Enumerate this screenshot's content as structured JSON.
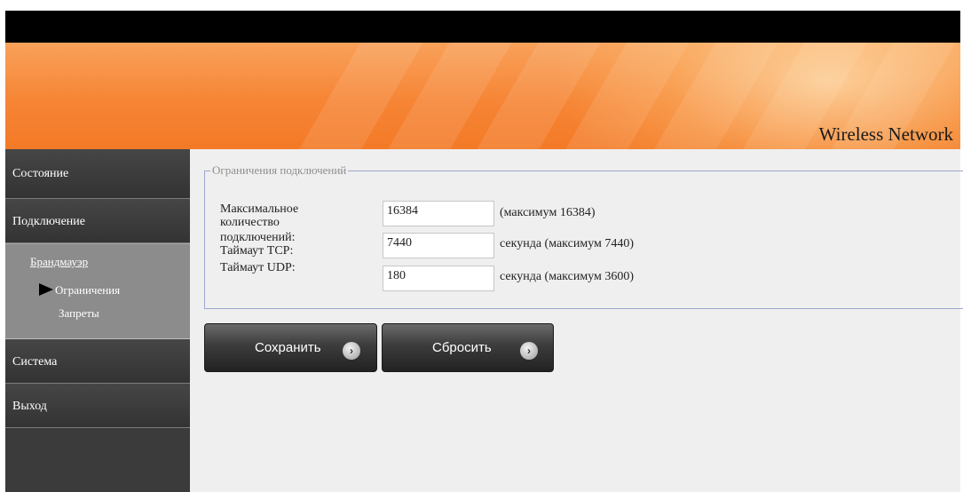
{
  "header": {
    "brand": "Wireless Network"
  },
  "sidebar": {
    "items": [
      {
        "label": "Состояние"
      },
      {
        "label": "Подключение"
      }
    ],
    "group": {
      "title": "Брандмауэр",
      "active": "Ограничения",
      "other": "Запреты"
    },
    "items_after": [
      {
        "label": "Система"
      },
      {
        "label": "Выход"
      }
    ]
  },
  "form": {
    "legend": "Ограничения подключений",
    "labels": {
      "max_line1": "Максимальное",
      "max_line2": "количество",
      "max_line3": "подключений:",
      "tcp": "Таймаут TCP:",
      "udp": "Таймаут UDP:"
    },
    "fields": {
      "max_connections": "16384",
      "tcp_timeout": "7440",
      "udp_timeout": "180"
    },
    "hints": {
      "max_connections": "(максимум 16384)",
      "tcp_timeout": "секунда (максимум 7440)",
      "udp_timeout": "секунда (максимум 3600)"
    }
  },
  "buttons": {
    "save": "Сохранить",
    "reset": "Сбросить",
    "arrow_glyph": "›"
  },
  "colors": {
    "banner": "#f68535",
    "sidebar": "#3b3b3b",
    "sidebar_group": "#8c8c8c",
    "fieldset_border": "#9ca7cc"
  }
}
